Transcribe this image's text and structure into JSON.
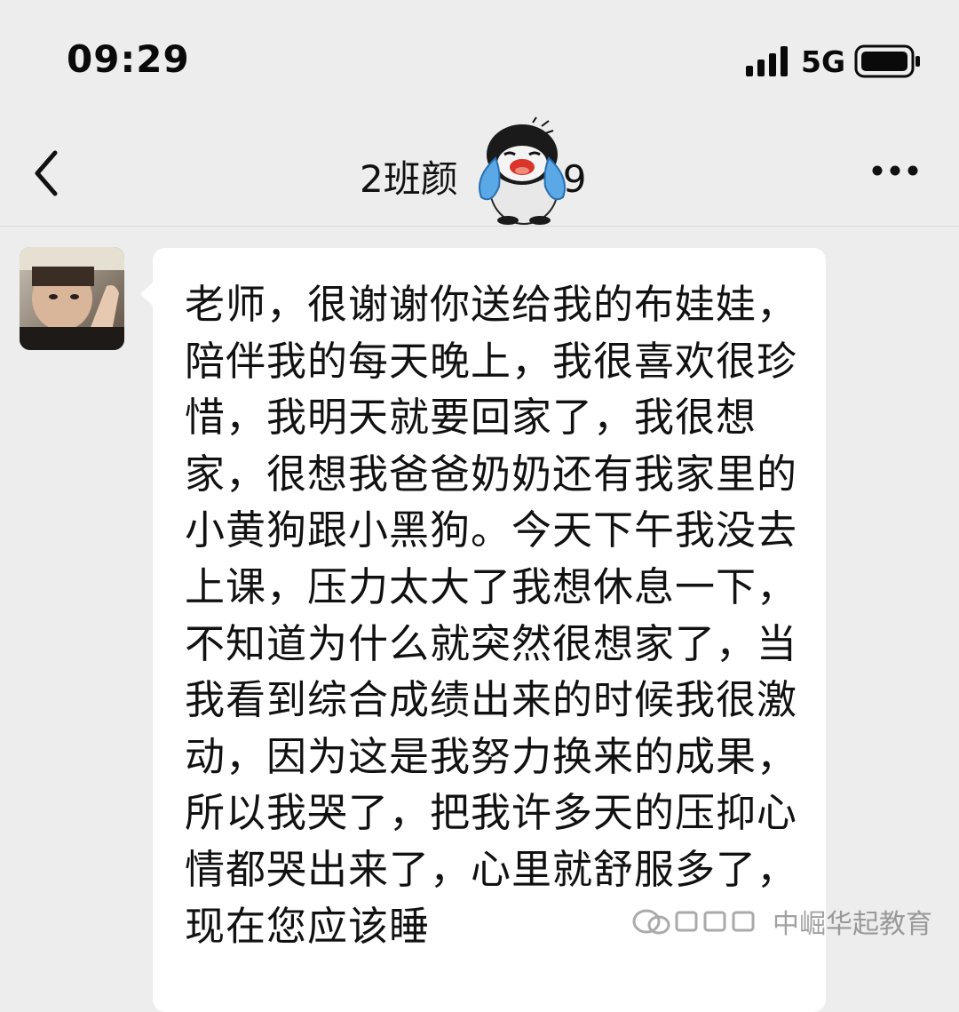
{
  "status_bar": {
    "time": "09:29",
    "network": "5G",
    "icons": [
      "signal-icon",
      "battery-icon"
    ]
  },
  "nav": {
    "title": "2班颜",
    "title_suffix": "9",
    "icons": [
      "back-icon",
      "crying-penguin-sticker-icon",
      "more-icon"
    ]
  },
  "message": {
    "text": "老师，很谢谢你送给我的布娃娃，陪伴我的每天晚上，我很喜欢很珍惜，我明天就要回家了，我很想家，很想我爸爸奶奶还有我家里的小黄狗跟小黑狗。今天下午我没去上课，压力太大了我想休息一下，不知道为什么就突然很想家了，当我看到综合成绩出来的时候我很激动，因为这是我努力换来的成果，所以我哭了，把我许多天的压抑心情都哭出来了，心里就舒服多了，现在您应该睡"
  },
  "watermark": {
    "text": "中崛华起教育"
  },
  "colors": {
    "background": "#ededed",
    "bubble": "#ffffff",
    "text": "#111111"
  }
}
